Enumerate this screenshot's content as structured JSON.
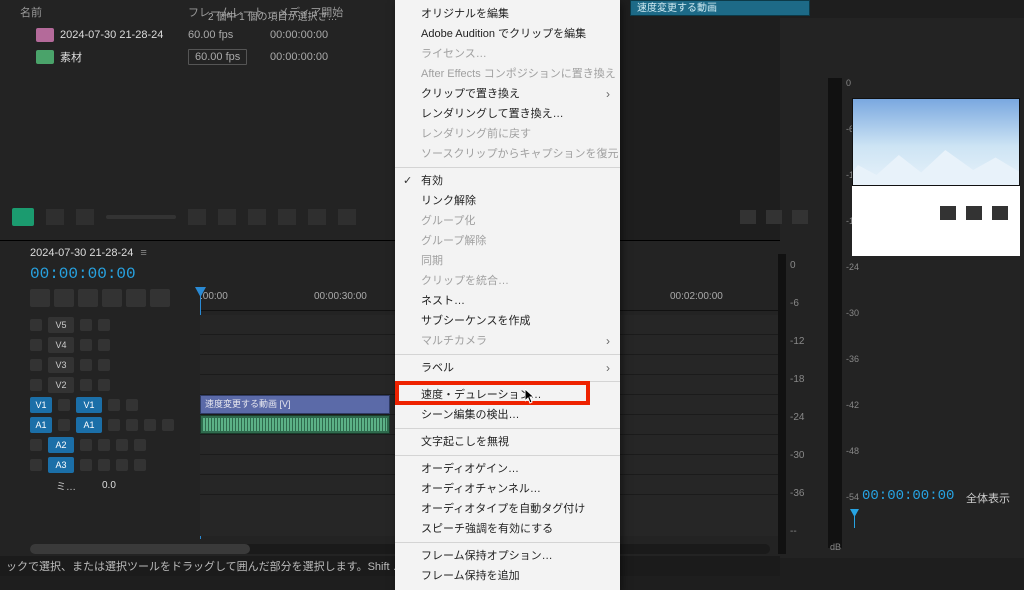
{
  "project": {
    "selection_info": "2 個中 1 個の項目が選択さ…",
    "columns": {
      "name": "名前",
      "framerate": "フレームレート",
      "media_start": "メディア開始"
    },
    "rows": [
      {
        "name": "2024-07-30 21-28-24",
        "framerate": "60.00 fps",
        "media_start": "00:00:00:00"
      },
      {
        "name": "素材",
        "framerate": "60.00 fps",
        "media_start": "00:00:00:00"
      }
    ]
  },
  "timeline": {
    "sequence_name": "2024-07-30 21-28-24",
    "timecode": "00:00:00:00",
    "ruler": [
      {
        "label": ":00:00",
        "px": 0
      },
      {
        "label": "00:00:30:00",
        "px": 114
      },
      {
        "label": "00:02:00:00",
        "px": 470
      }
    ],
    "video_tracks": [
      {
        "src": "",
        "label": "V5"
      },
      {
        "src": "",
        "label": "V4"
      },
      {
        "src": "",
        "label": "V3"
      },
      {
        "src": "",
        "label": "V2"
      },
      {
        "src": "V1",
        "label": "V1",
        "active": true
      }
    ],
    "audio_tracks": [
      {
        "src": "A1",
        "label": "A1",
        "active": true
      },
      {
        "src": "",
        "label": "A2"
      },
      {
        "src": "",
        "label": "A3"
      }
    ],
    "clip_v_name": "速度変更する動画 [V]",
    "master_label": "ミ…",
    "master_value": "0.0"
  },
  "program": {
    "clip_title": "速度変更する動画",
    "timecode": "00:00:00:00",
    "fit_label": "全体表示",
    "meter_ticks": [
      "0",
      "-6",
      "-12",
      "-18",
      "-24",
      "-30",
      "-36",
      "-42",
      "-48",
      "-54"
    ],
    "meter2_ticks": [
      "0",
      "-6",
      "-12",
      "-18",
      "-24",
      "-30",
      "-36",
      "--"
    ],
    "db_label": "dB"
  },
  "context_menu": {
    "items": [
      {
        "label": "オリジナルを編集",
        "state": "norm"
      },
      {
        "label": "Adobe Audition でクリップを編集",
        "state": "norm"
      },
      {
        "label": "ライセンス…",
        "state": "dis"
      },
      {
        "label": "After Effects コンポジションに置き換え",
        "state": "dis"
      },
      {
        "label": "クリップで置き換え",
        "state": "sub"
      },
      {
        "label": "レンダリングして置き換え…",
        "state": "norm"
      },
      {
        "label": "レンダリング前に戻す",
        "state": "dis"
      },
      {
        "label": "ソースクリップからキャプションを復元",
        "state": "dis"
      },
      {
        "sep": true
      },
      {
        "label": "有効",
        "state": "chk"
      },
      {
        "label": "リンク解除",
        "state": "norm"
      },
      {
        "label": "グループ化",
        "state": "dis"
      },
      {
        "label": "グループ解除",
        "state": "dis"
      },
      {
        "label": "同期",
        "state": "dis"
      },
      {
        "label": "クリップを統合…",
        "state": "dis"
      },
      {
        "label": "ネスト…",
        "state": "norm"
      },
      {
        "label": "サブシーケンスを作成",
        "state": "norm"
      },
      {
        "label": "マルチカメラ",
        "state": "dis sub"
      },
      {
        "sep": true
      },
      {
        "label": "ラベル",
        "state": "sub"
      },
      {
        "sep": true
      },
      {
        "label": "速度・デュレーション…",
        "state": "norm",
        "highlight": true
      },
      {
        "label": "シーン編集の検出…",
        "state": "norm"
      },
      {
        "sep": true
      },
      {
        "label": "文字起こしを無視",
        "state": "norm"
      },
      {
        "sep": true
      },
      {
        "label": "オーディオゲイン…",
        "state": "norm"
      },
      {
        "label": "オーディオチャンネル…",
        "state": "norm"
      },
      {
        "label": "オーディオタイプを自動タグ付け",
        "state": "norm"
      },
      {
        "label": "スピーチ強調を有効にする",
        "state": "norm"
      },
      {
        "sep": true
      },
      {
        "label": "フレーム保持オプション…",
        "state": "norm"
      },
      {
        "label": "フレーム保持を追加",
        "state": "norm"
      }
    ]
  },
  "footer_hint": "ックで選択、または選択ツールをドラッグして囲んだ部分を選択します。Shift …"
}
